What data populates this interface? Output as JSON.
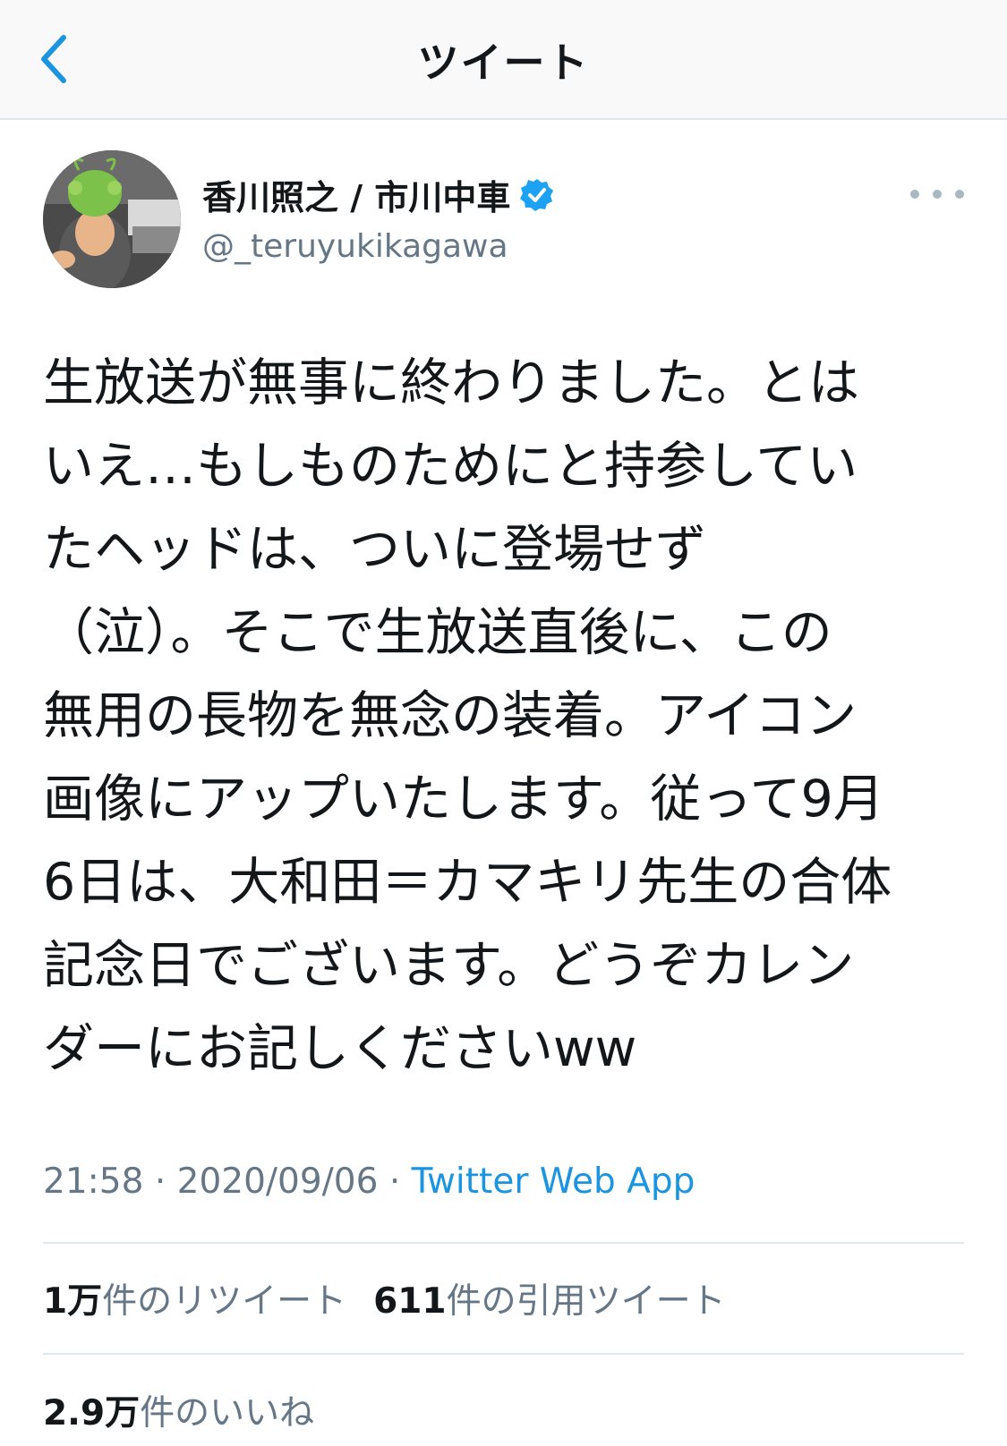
{
  "header": {
    "title": "ツイート"
  },
  "author": {
    "display_name": "香川照之 / 市川中車",
    "handle": "@_teruyukikagawa",
    "verified": true
  },
  "tweet": {
    "lines": [
      "生放送が無事に終わりました。とは",
      "いえ…もしものためにと持参してい",
      "たヘッドは、ついに登場せず",
      "（泣）。そこで生放送直後に、この",
      "無用の長物を無念の装着。アイコン",
      "画像にアップいたします。従って9月",
      "6日は、大和田＝カマキリ先生の合体",
      "記念日でございます。どうぞカレン",
      "ダーにお記しくださいww"
    ],
    "time": "21:58",
    "date": "2020/09/06",
    "separator": "·",
    "source": "Twitter Web App"
  },
  "stats": {
    "retweets_count": "1万",
    "retweets_label": "件のリツイート",
    "quotes_count": "611",
    "quotes_label": "件の引用ツイート",
    "likes_count": "2.9万",
    "likes_label": "件のいいね"
  },
  "colors": {
    "accent": "#1b95e0",
    "secondary_text": "#657786",
    "divider": "#e1e8ed",
    "verified": "#1da1f2"
  }
}
